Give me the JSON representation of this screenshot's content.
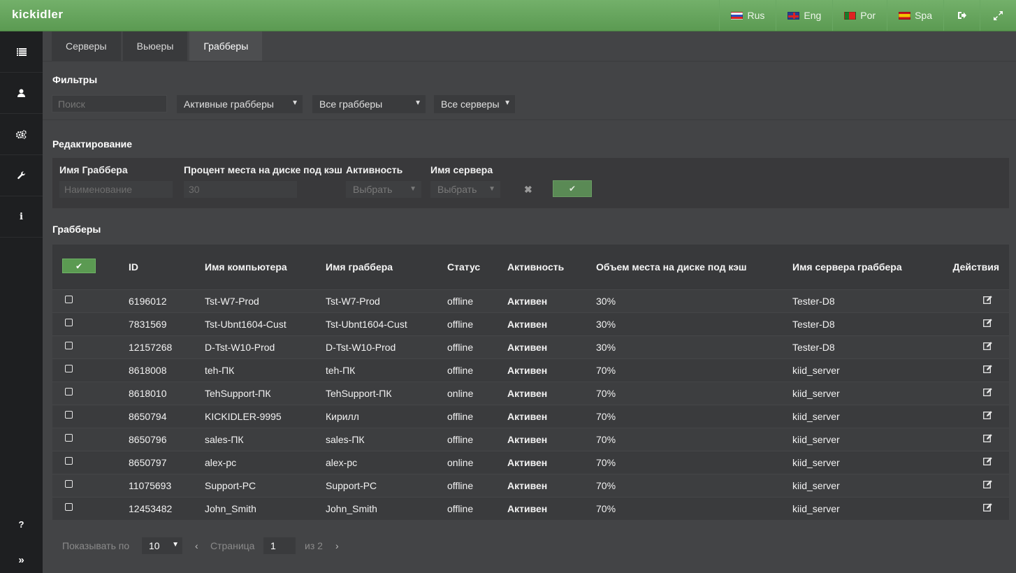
{
  "app": {
    "logo": "KICKIDLER"
  },
  "languages": [
    {
      "label": "Rus",
      "flag": "ru"
    },
    {
      "label": "Eng",
      "flag": "gb"
    },
    {
      "label": "Por",
      "flag": "pt"
    },
    {
      "label": "Spa",
      "flag": "es"
    }
  ],
  "tabs": [
    "Серверы",
    "Вьюеры",
    "Грабберы"
  ],
  "filters": {
    "title": "Фильтры",
    "search_placeholder": "Поиск",
    "status_select": "Активные грабберы",
    "grabbers_select": "Все грабберы",
    "servers_select": "Все серверы"
  },
  "edit": {
    "title": "Редактирование",
    "name_label": "Имя Граббера",
    "name_placeholder": "Наименование",
    "percent_label": "Процент места на диске под кэш",
    "percent_placeholder": "30",
    "activity_label": "Активность",
    "activity_select": "Выбрать",
    "server_label": "Имя сервера",
    "server_select": "Выбрать"
  },
  "table": {
    "title": "Грабберы",
    "headers": {
      "id": "ID",
      "computer": "Имя компьютера",
      "grabber": "Имя граббера",
      "status": "Статус",
      "activity": "Активность",
      "cache": "Объем места на диске под кэш",
      "server": "Имя сервера граббера",
      "actions": "Действия"
    },
    "rows": [
      {
        "id": "6196012",
        "computer": "Tst-W7-Prod",
        "grabber": "Tst-W7-Prod",
        "status": "offline",
        "activity": "Активен",
        "cache": "30%",
        "server": "Tester-D8"
      },
      {
        "id": "7831569",
        "computer": "Tst-Ubnt1604-Cust",
        "grabber": "Tst-Ubnt1604-Cust",
        "status": "offline",
        "activity": "Активен",
        "cache": "30%",
        "server": "Tester-D8"
      },
      {
        "id": "12157268",
        "computer": "D-Tst-W10-Prod",
        "grabber": "D-Tst-W10-Prod",
        "status": "offline",
        "activity": "Активен",
        "cache": "30%",
        "server": "Tester-D8"
      },
      {
        "id": "8618008",
        "computer": "teh-ПК",
        "grabber": "teh-ПК",
        "status": "offline",
        "activity": "Активен",
        "cache": "70%",
        "server": "kiid_server"
      },
      {
        "id": "8618010",
        "computer": "TehSupport-ПК",
        "grabber": "TehSupport-ПК",
        "status": "online",
        "activity": "Активен",
        "cache": "70%",
        "server": "kiid_server"
      },
      {
        "id": "8650794",
        "computer": "KICKIDLER-9995",
        "grabber": "Кирилл",
        "status": "offline",
        "activity": "Активен",
        "cache": "70%",
        "server": "kiid_server"
      },
      {
        "id": "8650796",
        "computer": "sales-ПК",
        "grabber": "sales-ПК",
        "status": "offline",
        "activity": "Активен",
        "cache": "70%",
        "server": "kiid_server"
      },
      {
        "id": "8650797",
        "computer": "alex-pc",
        "grabber": "alex-pc",
        "status": "online",
        "activity": "Активен",
        "cache": "70%",
        "server": "kiid_server"
      },
      {
        "id": "11075693",
        "computer": "Support-PC",
        "grabber": "Support-PC",
        "status": "offline",
        "activity": "Активен",
        "cache": "70%",
        "server": "kiid_server"
      },
      {
        "id": "12453482",
        "computer": "John_Smith",
        "grabber": "John_Smith",
        "status": "offline",
        "activity": "Активен",
        "cache": "70%",
        "server": "kiid_server"
      }
    ]
  },
  "pagination": {
    "show_label": "Показывать по",
    "per_page": "10",
    "prev": "‹",
    "page_label": "Страница",
    "page": "1",
    "of_label": "из 2",
    "next": "›"
  },
  "sidebar_icons": [
    "list-icon",
    "user-icon",
    "gears-icon",
    "wrench-icon",
    "info-icon"
  ],
  "colors": {
    "accent": "#5b9a52",
    "background": "#434446",
    "sidebar": "#1e1f21"
  }
}
